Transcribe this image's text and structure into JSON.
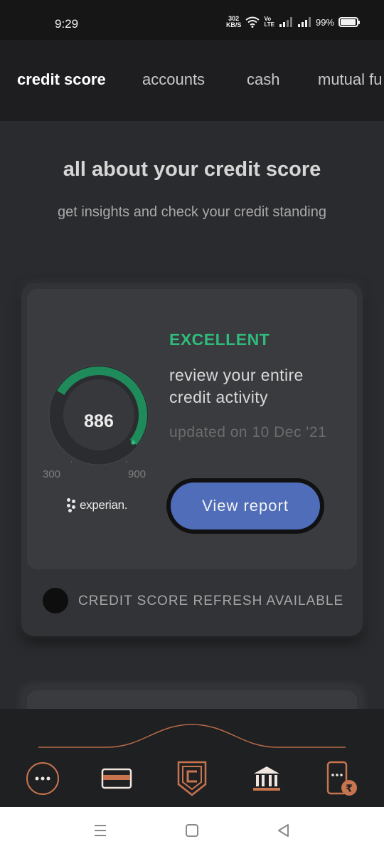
{
  "status_bar": {
    "time": "9:29",
    "net_speed_value": "302",
    "net_speed_unit": "KB/S",
    "volte_top": "Vo",
    "volte_bottom": "LTE",
    "battery": "99%",
    "battery_level_percent": 99
  },
  "tabs": [
    {
      "label": "credit score",
      "active": true
    },
    {
      "label": "accounts",
      "active": false
    },
    {
      "label": "cash",
      "active": false
    },
    {
      "label": "mutual fu",
      "active": false
    }
  ],
  "header": {
    "title": "all about your credit score",
    "subtitle": "get insights and check your credit standing"
  },
  "credit_card": {
    "score": "886",
    "score_min": "300",
    "score_max": "900",
    "score_value": 886,
    "score_range": [
      300,
      900
    ],
    "bureau": "experian.",
    "rating": "EXCELLENT",
    "rating_color": "#2fbb7c",
    "review_text": "review your entire credit activity",
    "updated_text": "updated on 10 Dec '21",
    "view_report_label": "View report",
    "button_color": "#4f6db8",
    "refresh_text": "CREDIT SCORE REFRESH AVAILABLE"
  },
  "bottom_nav": {
    "items": [
      {
        "icon": "more-dots-icon"
      },
      {
        "icon": "card-icon"
      },
      {
        "icon": "cred-logo-icon"
      },
      {
        "icon": "bank-icon"
      },
      {
        "icon": "phone-rupee-icon"
      }
    ],
    "accent_color": "#c8744f"
  },
  "system_nav": {
    "items": [
      {
        "icon": "menu-icon"
      },
      {
        "icon": "home-icon"
      },
      {
        "icon": "back-icon"
      }
    ]
  }
}
